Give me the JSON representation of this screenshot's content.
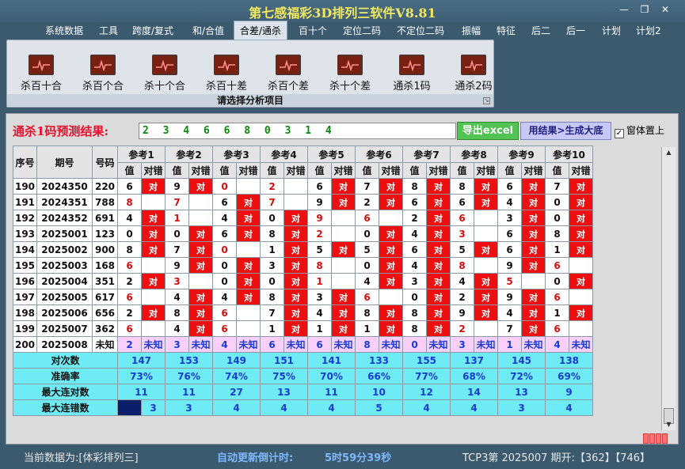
{
  "window": {
    "title": "第七感福彩3D排列三软件V8.81",
    "min_icon": "minimize-icon",
    "max_icon": "restore-icon",
    "close_icon": "close-icon",
    "min_glyph": "—",
    "max_glyph": "❐",
    "close_glyph": "✕"
  },
  "menu": [
    "系统数据",
    "工具",
    "跨度/复式",
    "和/合值",
    "合差/通杀",
    "百十个",
    "定位二码",
    "不定位二码",
    "振幅",
    "特征",
    "后二",
    "后一",
    "计划",
    "计划2"
  ],
  "menu_active": 4,
  "ribbon": {
    "items": [
      "杀百十合",
      "杀百个合",
      "杀十个合",
      "杀百十差",
      "杀百个差",
      "杀十个差",
      "通杀1码",
      "通杀2码"
    ],
    "caption": "请选择分析项目",
    "icon": "chart-icon"
  },
  "prediction": {
    "label": "通杀1码预测结果:",
    "value": "2 3 4 6 6 8 0 3 1 4"
  },
  "buttons": {
    "excel": "导出excel",
    "generate": "用结果>生成大底"
  },
  "topmost": {
    "label": "窗体置上",
    "checked": true,
    "check_glyph": "✓"
  },
  "table": {
    "headers": [
      "序号",
      "期号",
      "号码"
    ],
    "ref_headers": [
      "参考1",
      "参考2",
      "参考3",
      "参考4",
      "参考5",
      "参考6",
      "参考7",
      "参考8",
      "参考9",
      "参考10"
    ],
    "sub_val": "值",
    "sub_dc": "对错",
    "hit": "对",
    "rows": [
      {
        "seq": "190",
        "issue": "2024350",
        "num": "220",
        "v": [
          "6",
          "9",
          "0",
          "2",
          "6",
          "7",
          "8",
          "8",
          "6",
          "7"
        ],
        "h": [
          1,
          1,
          0,
          0,
          1,
          1,
          1,
          1,
          1,
          1
        ]
      },
      {
        "seq": "191",
        "issue": "2024351",
        "num": "788",
        "v": [
          "8",
          "7",
          "6",
          "7",
          "9",
          "2",
          "6",
          "6",
          "4",
          "0"
        ],
        "h": [
          0,
          0,
          1,
          0,
          1,
          1,
          1,
          1,
          1,
          1
        ]
      },
      {
        "seq": "192",
        "issue": "2024352",
        "num": "691",
        "v": [
          "4",
          "1",
          "4",
          "0",
          "9",
          "6",
          "2",
          "6",
          "3",
          "0"
        ],
        "h": [
          1,
          0,
          1,
          1,
          0,
          0,
          1,
          0,
          1,
          1
        ]
      },
      {
        "seq": "193",
        "issue": "2025001",
        "num": "123",
        "v": [
          "0",
          "0",
          "6",
          "8",
          "2",
          "0",
          "4",
          "3",
          "6",
          "8"
        ],
        "h": [
          1,
          1,
          1,
          1,
          0,
          1,
          1,
          0,
          1,
          1
        ]
      },
      {
        "seq": "194",
        "issue": "2025002",
        "num": "900",
        "v": [
          "8",
          "7",
          "0",
          "1",
          "5",
          "5",
          "6",
          "5",
          "6",
          "1"
        ],
        "h": [
          1,
          1,
          0,
          1,
          1,
          1,
          1,
          1,
          1,
          1
        ]
      },
      {
        "seq": "195",
        "issue": "2025003",
        "num": "168",
        "v": [
          "6",
          "9",
          "0",
          "3",
          "8",
          "0",
          "4",
          "8",
          "9",
          "6"
        ],
        "h": [
          0,
          1,
          1,
          1,
          0,
          1,
          1,
          0,
          1,
          0
        ]
      },
      {
        "seq": "196",
        "issue": "2025004",
        "num": "351",
        "v": [
          "2",
          "3",
          "0",
          "0",
          "1",
          "4",
          "3",
          "4",
          "5",
          "0"
        ],
        "h": [
          1,
          0,
          1,
          1,
          0,
          1,
          1,
          1,
          0,
          1
        ]
      },
      {
        "seq": "197",
        "issue": "2025005",
        "num": "617",
        "v": [
          "6",
          "4",
          "4",
          "8",
          "3",
          "6",
          "0",
          "2",
          "9",
          "6"
        ],
        "h": [
          0,
          1,
          1,
          1,
          1,
          0,
          1,
          1,
          1,
          0
        ]
      },
      {
        "seq": "198",
        "issue": "2025006",
        "num": "656",
        "v": [
          "2",
          "8",
          "6",
          "7",
          "4",
          "8",
          "8",
          "9",
          "4",
          "1"
        ],
        "h": [
          1,
          1,
          0,
          1,
          1,
          1,
          1,
          1,
          1,
          1
        ]
      },
      {
        "seq": "199",
        "issue": "2025007",
        "num": "362",
        "v": [
          "6",
          "4",
          "6",
          "1",
          "1",
          "1",
          "8",
          "2",
          "7",
          "6"
        ],
        "h": [
          0,
          1,
          0,
          1,
          1,
          1,
          1,
          0,
          1,
          0
        ]
      }
    ],
    "pending": {
      "seq": "200",
      "issue": "2025008",
      "num": "未知",
      "v": [
        "2",
        "3",
        "4",
        "6",
        "6",
        "8",
        "0",
        "3",
        "1",
        "4"
      ],
      "unknown": "未知"
    },
    "summary": [
      {
        "label": "对次数",
        "vals": [
          "147",
          "153",
          "149",
          "151",
          "141",
          "133",
          "155",
          "137",
          "145",
          "138"
        ]
      },
      {
        "label": "准确率",
        "vals": [
          "73%",
          "76%",
          "74%",
          "75%",
          "70%",
          "66%",
          "77%",
          "68%",
          "72%",
          "69%"
        ]
      },
      {
        "label": "最大连对数",
        "vals": [
          "11",
          "11",
          "27",
          "13",
          "11",
          "10",
          "12",
          "14",
          "13",
          "9"
        ]
      },
      {
        "label": "最大连错数",
        "vals": [
          "3",
          "3",
          "4",
          "4",
          "4",
          "5",
          "4",
          "4",
          "3",
          "4"
        ]
      }
    ]
  },
  "status": {
    "current_label": "当前数据为:[体彩排列三]",
    "countdown_label": "自动更新倒计时:",
    "countdown": "5时59分39秒",
    "info": "TCP3第  2025007  期开:【362】【746】"
  },
  "scroll": {
    "up_glyph": "▲",
    "down_glyph": "▼"
  },
  "colors": {
    "hit_bg": "#ee1010",
    "summary_bg": "#6eebf4",
    "pending_bg": "#fad0fa",
    "title": "#f0e860",
    "pred_label": "#e8102a"
  }
}
